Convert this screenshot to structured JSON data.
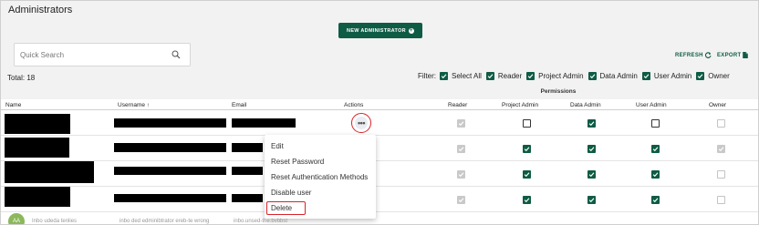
{
  "page": {
    "title": "Administrators"
  },
  "toolbar": {
    "new_admin_label": "NEW ADMINISTRATOR",
    "search_placeholder": "Quick Search",
    "refresh_label": "REFRESH",
    "export_label": "EXPORT",
    "total_label": "Total: 18"
  },
  "filter": {
    "label": "Filter:",
    "options": [
      "Select All",
      "Reader",
      "Project Admin",
      "Data Admin",
      "User Admin",
      "Owner"
    ],
    "checked": [
      true,
      true,
      true,
      true,
      true,
      true
    ]
  },
  "table": {
    "permissions_group": "Permissions",
    "columns": {
      "name": "Name",
      "username": "Username ↑",
      "email": "Email",
      "actions": "Actions",
      "reader": "Reader",
      "project_admin": "Project Admin",
      "data_admin": "Data Admin",
      "user_admin": "User Admin",
      "owner": "Owner"
    },
    "rows": [
      {
        "reader": true,
        "project_admin": false,
        "data_admin": true,
        "user_admin": false,
        "owner": false
      },
      {
        "reader": true,
        "project_admin": true,
        "data_admin": true,
        "user_admin": true,
        "owner": true
      },
      {
        "reader": true,
        "project_admin": true,
        "data_admin": true,
        "user_admin": true,
        "owner": false
      },
      {
        "reader": true,
        "project_admin": true,
        "data_admin": true,
        "user_admin": true,
        "owner": false
      }
    ],
    "partial_row": {
      "name": "Inbo udeda tenlies",
      "username": "inbo ded edminibtrator ereb-te wrong",
      "email": "inbo.unsed-the.bvbbst"
    }
  },
  "actions_menu": {
    "items": [
      "Edit",
      "Reset Password",
      "Reset Authentication Methods",
      "Disable user",
      "Delete"
    ]
  },
  "colors": {
    "brand_green": "#0f5c45",
    "highlight_red": "#d8232a",
    "header_bg": "#f2f2f2"
  },
  "icons": {
    "new_admin": "plus-circle-icon",
    "search": "search-icon",
    "refresh": "refresh-icon",
    "export": "export-file-icon",
    "actions": "more-horizontal-icon",
    "checkbox": "check-icon"
  }
}
